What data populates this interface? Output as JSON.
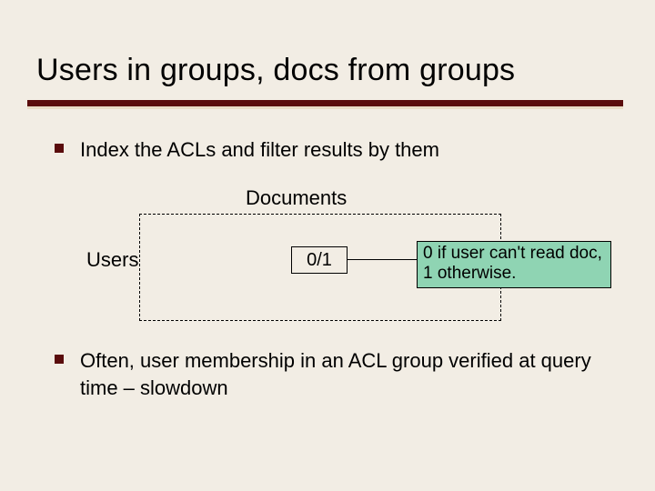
{
  "title": "Users in groups, docs from groups",
  "bullets": [
    "Index the ACLs and filter results by them",
    "Often, user membership in an ACL group verified at query time – slowdown"
  ],
  "diagram": {
    "documents_label": "Documents",
    "users_label": "Users",
    "value": "0/1",
    "note": "0 if user can't read doc, 1 otherwise."
  },
  "colors": {
    "background": "#f2ede4",
    "accent_dark": "#5a0c0c",
    "note_fill": "#8fd4b3"
  }
}
